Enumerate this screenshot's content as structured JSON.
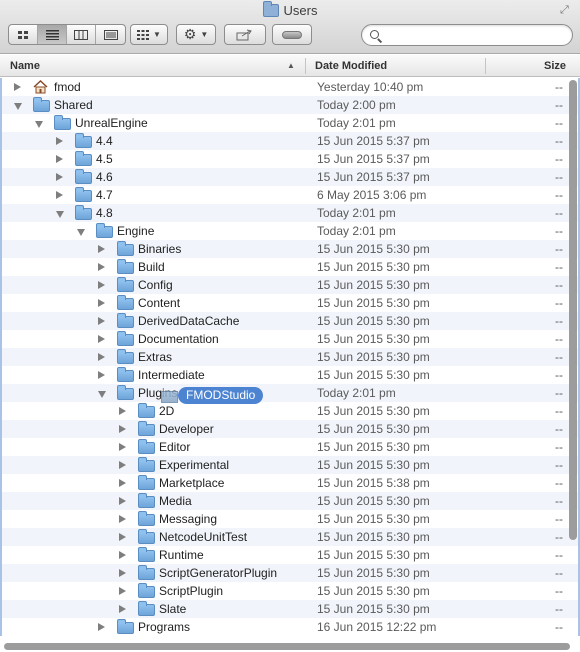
{
  "window": {
    "title": "Users"
  },
  "toolbar": {
    "view_buttons": [
      {
        "name": "icon-view",
        "active": false
      },
      {
        "name": "list-view",
        "active": true
      },
      {
        "name": "column-view",
        "active": false
      },
      {
        "name": "cover-flow-view",
        "active": false
      }
    ],
    "arrange_icon": "arrange-grid-icon",
    "action_icon": "gear-icon",
    "share_icon": "share-icon",
    "tags_icon": "tags-icon",
    "search_value": "",
    "search_placeholder": ""
  },
  "columns": {
    "name": "Name",
    "date_modified": "Date Modified",
    "size": "Size"
  },
  "accent": "#4c84d2",
  "folder_color": "#7fb2e5",
  "drag": {
    "badge": "FMODStudio"
  },
  "rows": [
    {
      "name": "fmod",
      "date": "Yesterday 10:40 pm",
      "size": "--",
      "indent": 0,
      "state": "closed",
      "icon": "home-folder-icon"
    },
    {
      "name": "Shared",
      "date": "Today 2:00 pm",
      "size": "--",
      "indent": 0,
      "state": "open",
      "icon": "folder-icon"
    },
    {
      "name": "UnrealEngine",
      "date": "Today 2:01 pm",
      "size": "--",
      "indent": 1,
      "state": "open",
      "icon": "folder-icon"
    },
    {
      "name": "4.4",
      "date": "15 Jun 2015 5:37 pm",
      "size": "--",
      "indent": 2,
      "state": "closed",
      "icon": "folder-icon"
    },
    {
      "name": "4.5",
      "date": "15 Jun 2015 5:37 pm",
      "size": "--",
      "indent": 2,
      "state": "closed",
      "icon": "folder-icon"
    },
    {
      "name": "4.6",
      "date": "15 Jun 2015 5:37 pm",
      "size": "--",
      "indent": 2,
      "state": "closed",
      "icon": "folder-icon"
    },
    {
      "name": "4.7",
      "date": "6 May 2015 3:06 pm",
      "size": "--",
      "indent": 2,
      "state": "closed",
      "icon": "folder-icon"
    },
    {
      "name": "4.8",
      "date": "Today 2:01 pm",
      "size": "--",
      "indent": 2,
      "state": "open",
      "icon": "folder-icon"
    },
    {
      "name": "Engine",
      "date": "Today 2:01 pm",
      "size": "--",
      "indent": 3,
      "state": "open",
      "icon": "folder-icon"
    },
    {
      "name": "Binaries",
      "date": "15 Jun 2015 5:30 pm",
      "size": "--",
      "indent": 4,
      "state": "closed",
      "icon": "folder-icon"
    },
    {
      "name": "Build",
      "date": "15 Jun 2015 5:30 pm",
      "size": "--",
      "indent": 4,
      "state": "closed",
      "icon": "folder-icon"
    },
    {
      "name": "Config",
      "date": "15 Jun 2015 5:30 pm",
      "size": "--",
      "indent": 4,
      "state": "closed",
      "icon": "folder-icon"
    },
    {
      "name": "Content",
      "date": "15 Jun 2015 5:30 pm",
      "size": "--",
      "indent": 4,
      "state": "closed",
      "icon": "folder-icon"
    },
    {
      "name": "DerivedDataCache",
      "date": "15 Jun 2015 5:30 pm",
      "size": "--",
      "indent": 4,
      "state": "closed",
      "icon": "folder-icon"
    },
    {
      "name": "Documentation",
      "date": "15 Jun 2015 5:30 pm",
      "size": "--",
      "indent": 4,
      "state": "closed",
      "icon": "folder-icon"
    },
    {
      "name": "Extras",
      "date": "15 Jun 2015 5:30 pm",
      "size": "--",
      "indent": 4,
      "state": "closed",
      "icon": "folder-icon"
    },
    {
      "name": "Intermediate",
      "date": "15 Jun 2015 5:30 pm",
      "size": "--",
      "indent": 4,
      "state": "closed",
      "icon": "folder-icon"
    },
    {
      "name": "Plugins",
      "date": "Today 2:01 pm",
      "size": "--",
      "indent": 4,
      "state": "open",
      "icon": "folder-icon"
    },
    {
      "name": "2D",
      "date": "15 Jun 2015 5:30 pm",
      "size": "--",
      "indent": 5,
      "state": "closed",
      "icon": "folder-icon"
    },
    {
      "name": "Developer",
      "date": "15 Jun 2015 5:30 pm",
      "size": "--",
      "indent": 5,
      "state": "closed",
      "icon": "folder-icon"
    },
    {
      "name": "Editor",
      "date": "15 Jun 2015 5:30 pm",
      "size": "--",
      "indent": 5,
      "state": "closed",
      "icon": "folder-icon"
    },
    {
      "name": "Experimental",
      "date": "15 Jun 2015 5:30 pm",
      "size": "--",
      "indent": 5,
      "state": "closed",
      "icon": "folder-icon"
    },
    {
      "name": "Marketplace",
      "date": "15 Jun 2015 5:38 pm",
      "size": "--",
      "indent": 5,
      "state": "closed",
      "icon": "folder-icon"
    },
    {
      "name": "Media",
      "date": "15 Jun 2015 5:30 pm",
      "size": "--",
      "indent": 5,
      "state": "closed",
      "icon": "folder-icon"
    },
    {
      "name": "Messaging",
      "date": "15 Jun 2015 5:30 pm",
      "size": "--",
      "indent": 5,
      "state": "closed",
      "icon": "folder-icon"
    },
    {
      "name": "NetcodeUnitTest",
      "date": "15 Jun 2015 5:30 pm",
      "size": "--",
      "indent": 5,
      "state": "closed",
      "icon": "folder-icon"
    },
    {
      "name": "Runtime",
      "date": "15 Jun 2015 5:30 pm",
      "size": "--",
      "indent": 5,
      "state": "closed",
      "icon": "folder-icon"
    },
    {
      "name": "ScriptGeneratorPlugin",
      "date": "15 Jun 2015 5:30 pm",
      "size": "--",
      "indent": 5,
      "state": "closed",
      "icon": "folder-icon"
    },
    {
      "name": "ScriptPlugin",
      "date": "15 Jun 2015 5:30 pm",
      "size": "--",
      "indent": 5,
      "state": "closed",
      "icon": "folder-icon"
    },
    {
      "name": "Slate",
      "date": "15 Jun 2015 5:30 pm",
      "size": "--",
      "indent": 5,
      "state": "closed",
      "icon": "folder-icon"
    },
    {
      "name": "Programs",
      "date": "16 Jun 2015 12:22 pm",
      "size": "--",
      "indent": 4,
      "state": "closed",
      "icon": "folder-icon"
    }
  ]
}
